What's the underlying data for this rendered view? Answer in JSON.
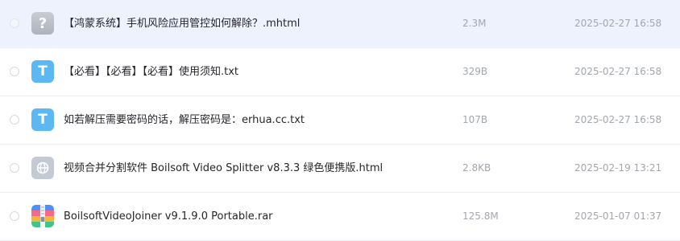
{
  "files": [
    {
      "name": "【鸿蒙系统】手机风险应用管控如何解除？.mhtml",
      "size": "2.3M",
      "date": "2025-02-27 16:58",
      "icon": "unknown-file-icon",
      "icon_glyph": "?",
      "selected": true
    },
    {
      "name": "【必看】【必看】【必看】使用须知.txt",
      "size": "329B",
      "date": "2025-02-27 16:58",
      "icon": "txt-file-icon",
      "icon_glyph": "T",
      "selected": false
    },
    {
      "name": "如若解压需要密码的话，解压密码是：erhua.cc.txt",
      "size": "107B",
      "date": "2025-02-27 16:58",
      "icon": "txt-file-icon",
      "icon_glyph": "T",
      "selected": false
    },
    {
      "name": "视频合并分割软件 Boilsoft Video Splitter v8.3.3 绿色便携版.html",
      "size": "2.8KB",
      "date": "2025-02-19 13:21",
      "icon": "html-file-icon",
      "selected": false
    },
    {
      "name": "BoilsoftVideoJoiner v9.1.9.0 Portable.rar",
      "size": "125.8M",
      "date": "2025-01-07 01:37",
      "icon": "rar-archive-icon",
      "selected": false
    }
  ],
  "colors": {
    "selected_row_bg": "#eef2fd",
    "txt_icon": "#5cb8f2",
    "unknown_icon": "#b9bdc5",
    "html_icon": "#c4cad3",
    "meta_text": "#a2a6ad",
    "name_text": "#25262b"
  }
}
